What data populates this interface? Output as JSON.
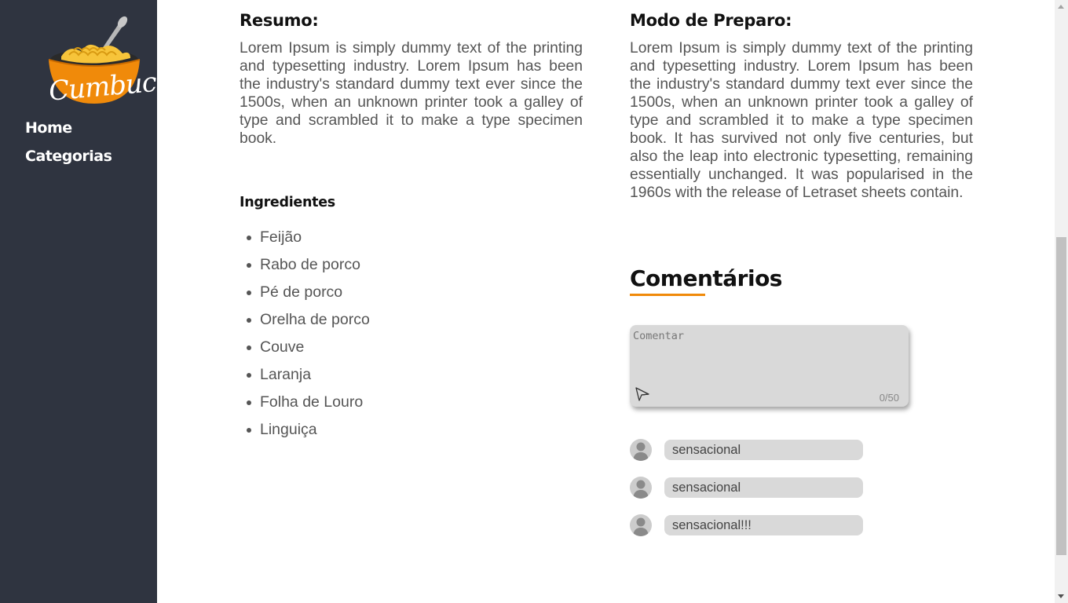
{
  "sidebar": {
    "logo_text": "Cumbuca",
    "items": [
      {
        "label": "Home"
      },
      {
        "label": "Categorias"
      }
    ],
    "background": "#2f3440"
  },
  "resumo": {
    "title": "Resumo:",
    "text": "Lorem Ipsum is simply dummy text of the printing and typesetting industry. Lorem Ipsum has been the industry's standard dummy text ever since the 1500s, when an unknown printer took a galley of type and scrambled it to make a type specimen book."
  },
  "modo_preparo": {
    "title": "Modo de Preparo:",
    "text": "Lorem Ipsum is simply dummy text of the printing and typesetting industry. Lorem Ipsum has been the industry's standard dummy text ever since the 1500s, when an unknown printer took a galley of type and scrambled it to make a type specimen book. It has survived not only five centuries, but also the leap into electronic typesetting, remaining essentially unchanged. It was popularised in the 1960s with the release of Letraset sheets contain."
  },
  "ingredientes": {
    "title": "Ingredientes",
    "items": [
      "Feijão",
      "Rabo de porco",
      "Pé de porco",
      "Orelha de porco",
      "Couve",
      "Laranja",
      "Folha de Louro",
      "Linguiça"
    ]
  },
  "comentarios": {
    "title": "Comentários",
    "accent_color": "#f08a0a",
    "input": {
      "placeholder": "Comentar",
      "value": "",
      "counter": "0/50",
      "send_icon": "send-icon"
    },
    "list": [
      {
        "text": "sensacional",
        "avatar_icon": "user-avatar-icon"
      },
      {
        "text": "sensacional",
        "avatar_icon": "user-avatar-icon"
      },
      {
        "text": "sensacional!!!",
        "avatar_icon": "user-avatar-icon"
      }
    ]
  }
}
